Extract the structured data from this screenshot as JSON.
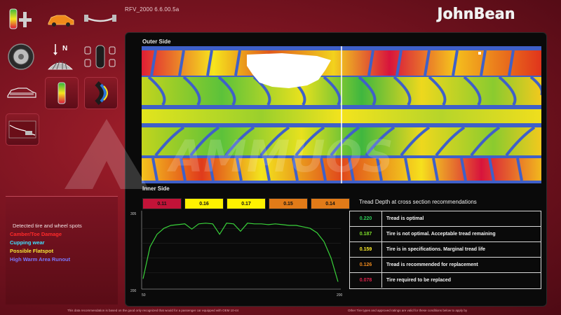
{
  "header": {
    "app_title": "RFV_2000   6.6.00.5a",
    "brand": "JohnBean"
  },
  "sidebar": {
    "tools": [
      {
        "name": "tire-gauge-tool",
        "icon": "color-gauge-icon"
      },
      {
        "name": "car-view-tool",
        "icon": "car-icon"
      },
      {
        "name": "axle-view-tool",
        "icon": "axle-icon"
      },
      {
        "name": "wheel-tool",
        "icon": "wheel-icon"
      },
      {
        "name": "tread-north-tool",
        "icon": "tread-north-icon"
      },
      {
        "name": "four-wheel-tool",
        "icon": "four-wheel-icon"
      },
      {
        "name": "car-outline-tool",
        "icon": "car-outline-icon"
      },
      {
        "name": "tread-gauge-tool",
        "icon": "tread-gauge-icon"
      },
      {
        "name": "tire-profile-tool",
        "icon": "tire-profile-icon"
      },
      {
        "name": "tread-profile-tool",
        "icon": "tread-profile-icon"
      }
    ],
    "legend": {
      "title": "Detected tire and wheel spots",
      "items": [
        {
          "label": "Camber/Toe Damage",
          "color": "#ff2a2a"
        },
        {
          "label": "Cupping wear",
          "color": "#3fe0ff"
        },
        {
          "label": "Possible Flatspot",
          "color": "#f3e83a"
        },
        {
          "label": "High Warm Area Runout",
          "color": "#7a78ff"
        }
      ]
    }
  },
  "main": {
    "outer_label": "Outer Side",
    "inner_label": "Inner Side",
    "readings": [
      {
        "value": "0.11",
        "color": "#c21338"
      },
      {
        "value": "0.16",
        "color": "#fff200"
      },
      {
        "value": "0.17",
        "color": "#fff200"
      },
      {
        "value": "0.15",
        "color": "#e27b18"
      },
      {
        "value": "0.14",
        "color": "#e27b18"
      }
    ],
    "recommendations": {
      "title": "Tread Depth at cross section recommendations",
      "rows": [
        {
          "value": "0.220",
          "text": "Tread is optimal",
          "color": "#2fd05a"
        },
        {
          "value": "0.187",
          "text": "Tire is not optimal. Acceptable tread remaining",
          "color": "#7fe02a"
        },
        {
          "value": "0.159",
          "text": "Tire is in specifications. Marginal tread life",
          "color": "#ffef2a"
        },
        {
          "value": "0.126",
          "text": "Tread is recommended for replacement",
          "color": "#ef8a1c"
        },
        {
          "value": "0.078",
          "text": "Tire required to be replaced",
          "color": "#e0234c"
        }
      ]
    }
  },
  "chart_data": {
    "type": "line",
    "ylim_labels": [
      "305",
      "200"
    ],
    "xlim_labels": [
      "50",
      "200"
    ],
    "series": [
      {
        "color": "#39d23a",
        "y": [
          0.12,
          0.55,
          0.72,
          0.8,
          0.84,
          0.85,
          0.86,
          0.79,
          0.86,
          0.87,
          0.86,
          0.72,
          0.87,
          0.86,
          0.76,
          0.87,
          0.86,
          0.86,
          0.85,
          0.86,
          0.85,
          0.84,
          0.84,
          0.82,
          0.8,
          0.74,
          0.62,
          0.4,
          0.08
        ]
      }
    ]
  },
  "footer": {
    "left": "This data recommendation is based on the good only recognized that would for a passenger car equipped with OEM 10-44",
    "right": "Other Tire types and approved ratings are valid for these conditions below to apply by"
  },
  "colors": {
    "accent": "#c21338",
    "panel": "#0a0a0a",
    "tread_low": "#d8143c",
    "tread_mid": "#f6e51d",
    "tread_high": "#28b23f",
    "tread_base": "#3f60c8"
  }
}
